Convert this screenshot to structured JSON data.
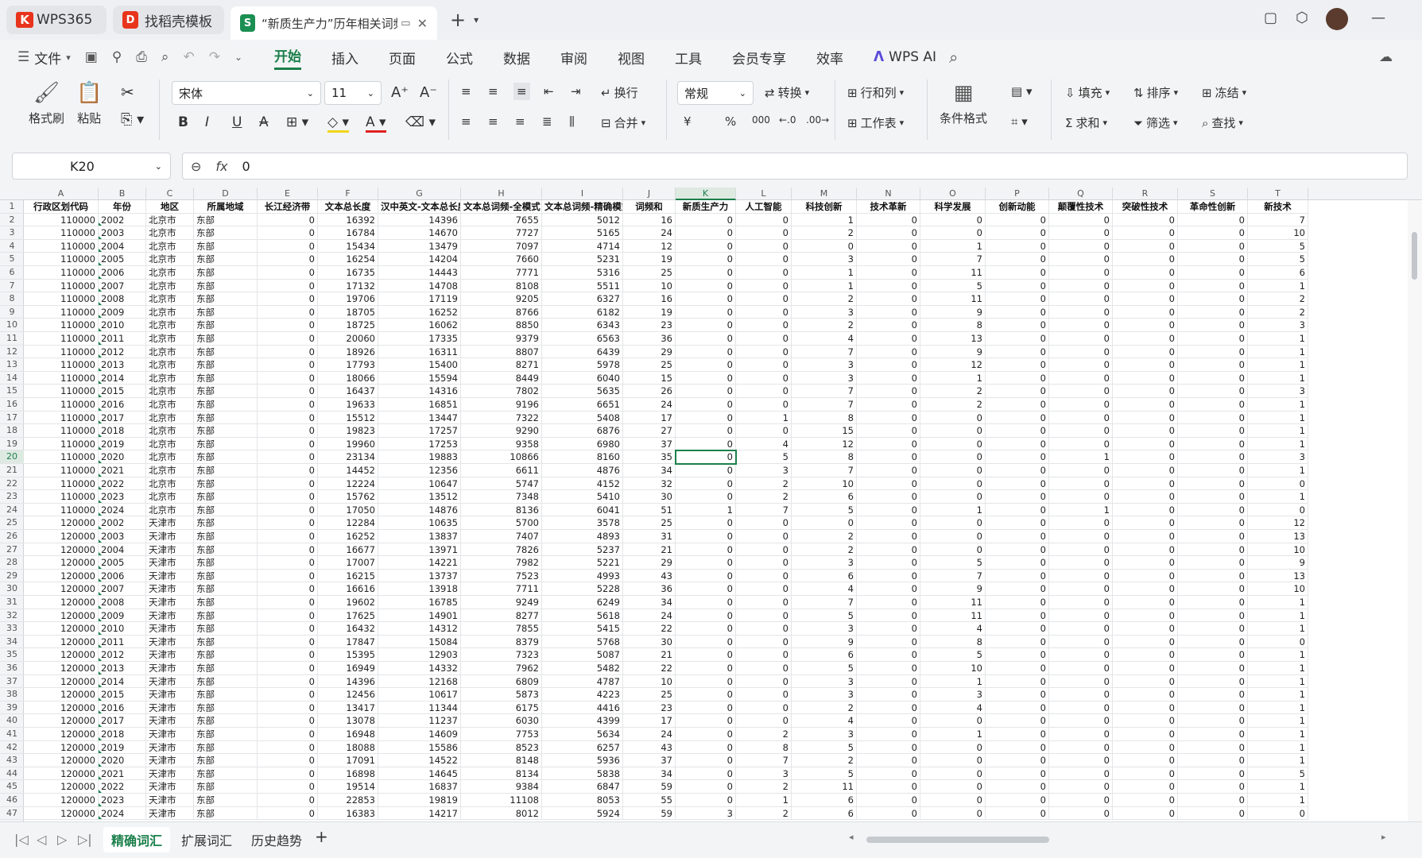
{
  "titlebar": {
    "tabs": [
      {
        "label": "WPS365"
      },
      {
        "label": "找稻壳模板"
      },
      {
        "label": "“新质生产力”历年相关词频-"
      }
    ],
    "new_tab": "+"
  },
  "menubar": {
    "file": "文件",
    "items": [
      "开始",
      "插入",
      "页面",
      "公式",
      "数据",
      "审阅",
      "视图",
      "工具",
      "会员专享",
      "效率"
    ],
    "active": "开始",
    "wps_ai": "WPS AI"
  },
  "ribbon": {
    "format_painter": "格式刷",
    "paste": "粘贴",
    "font_name": "宋体",
    "font_size": "11",
    "wrap": "换行",
    "merge": "合并",
    "number_format": "常规",
    "convert": "转换",
    "rows_cols": "行和列",
    "worksheet": "工作表",
    "cond_format": "条件格式",
    "fill": "填充",
    "sort": "排序",
    "freeze": "冻结",
    "sum": "求和",
    "filter": "筛选",
    "find": "查找",
    "bold": "B",
    "italic": "I",
    "underline": "U",
    "strike": "A",
    "currency": "¥",
    "percent": "%",
    "thousands": "000"
  },
  "formula_bar": {
    "cell_ref": "K20",
    "fx": "fx",
    "value": "0"
  },
  "grid": {
    "col_letters": [
      "A",
      "B",
      "C",
      "D",
      "E",
      "F",
      "G",
      "H",
      "I",
      "J",
      "K",
      "L",
      "M",
      "N",
      "O",
      "P",
      "Q",
      "R",
      "S",
      "T"
    ],
    "headers": [
      "行政区划代码",
      "年份",
      "地区",
      "所属地域",
      "长江经济带",
      "文本总长度",
      "汉中英文-文本总长度",
      "文本总词频-全模式",
      "文本总词频-精确模式",
      "词频和",
      "新质生产力",
      "人工智能",
      "科技创新",
      "技术革新",
      "科学发展",
      "创新动能",
      "颠覆性技术",
      "突破性技术",
      "革命性创新",
      "新技术"
    ],
    "rows": [
      [
        "110000",
        "2002",
        "北京市",
        "东部",
        "0",
        "16392",
        "14396",
        "7655",
        "5012",
        "16",
        "0",
        "0",
        "1",
        "0",
        "0",
        "0",
        "0",
        "0",
        "0",
        "7"
      ],
      [
        "110000",
        "2003",
        "北京市",
        "东部",
        "0",
        "16784",
        "14670",
        "7727",
        "5165",
        "24",
        "0",
        "0",
        "2",
        "0",
        "0",
        "0",
        "0",
        "0",
        "0",
        "10"
      ],
      [
        "110000",
        "2004",
        "北京市",
        "东部",
        "0",
        "15434",
        "13479",
        "7097",
        "4714",
        "12",
        "0",
        "0",
        "0",
        "0",
        "1",
        "0",
        "0",
        "0",
        "0",
        "5"
      ],
      [
        "110000",
        "2005",
        "北京市",
        "东部",
        "0",
        "16254",
        "14204",
        "7660",
        "5231",
        "19",
        "0",
        "0",
        "3",
        "0",
        "7",
        "0",
        "0",
        "0",
        "0",
        "5"
      ],
      [
        "110000",
        "2006",
        "北京市",
        "东部",
        "0",
        "16735",
        "14443",
        "7771",
        "5316",
        "25",
        "0",
        "0",
        "1",
        "0",
        "11",
        "0",
        "0",
        "0",
        "0",
        "6"
      ],
      [
        "110000",
        "2007",
        "北京市",
        "东部",
        "0",
        "17132",
        "14708",
        "8108",
        "5511",
        "10",
        "0",
        "0",
        "1",
        "0",
        "5",
        "0",
        "0",
        "0",
        "0",
        "1"
      ],
      [
        "110000",
        "2008",
        "北京市",
        "东部",
        "0",
        "19706",
        "17119",
        "9205",
        "6327",
        "16",
        "0",
        "0",
        "2",
        "0",
        "11",
        "0",
        "0",
        "0",
        "0",
        "2"
      ],
      [
        "110000",
        "2009",
        "北京市",
        "东部",
        "0",
        "18705",
        "16252",
        "8766",
        "6182",
        "19",
        "0",
        "0",
        "3",
        "0",
        "9",
        "0",
        "0",
        "0",
        "0",
        "2"
      ],
      [
        "110000",
        "2010",
        "北京市",
        "东部",
        "0",
        "18725",
        "16062",
        "8850",
        "6343",
        "23",
        "0",
        "0",
        "2",
        "0",
        "8",
        "0",
        "0",
        "0",
        "0",
        "3"
      ],
      [
        "110000",
        "2011",
        "北京市",
        "东部",
        "0",
        "20060",
        "17335",
        "9379",
        "6563",
        "36",
        "0",
        "0",
        "4",
        "0",
        "13",
        "0",
        "0",
        "0",
        "0",
        "1"
      ],
      [
        "110000",
        "2012",
        "北京市",
        "东部",
        "0",
        "18926",
        "16311",
        "8807",
        "6439",
        "29",
        "0",
        "0",
        "7",
        "0",
        "9",
        "0",
        "0",
        "0",
        "0",
        "1"
      ],
      [
        "110000",
        "2013",
        "北京市",
        "东部",
        "0",
        "17793",
        "15400",
        "8271",
        "5978",
        "25",
        "0",
        "0",
        "3",
        "0",
        "12",
        "0",
        "0",
        "0",
        "0",
        "1"
      ],
      [
        "110000",
        "2014",
        "北京市",
        "东部",
        "0",
        "18066",
        "15594",
        "8449",
        "6040",
        "15",
        "0",
        "0",
        "3",
        "0",
        "1",
        "0",
        "0",
        "0",
        "0",
        "1"
      ],
      [
        "110000",
        "2015",
        "北京市",
        "东部",
        "0",
        "16437",
        "14316",
        "7802",
        "5635",
        "26",
        "0",
        "0",
        "7",
        "0",
        "2",
        "0",
        "0",
        "0",
        "0",
        "3"
      ],
      [
        "110000",
        "2016",
        "北京市",
        "东部",
        "0",
        "19633",
        "16851",
        "9196",
        "6651",
        "24",
        "0",
        "0",
        "7",
        "0",
        "2",
        "0",
        "0",
        "0",
        "0",
        "1"
      ],
      [
        "110000",
        "2017",
        "北京市",
        "东部",
        "0",
        "15512",
        "13447",
        "7322",
        "5408",
        "17",
        "0",
        "1",
        "8",
        "0",
        "0",
        "0",
        "0",
        "0",
        "0",
        "1"
      ],
      [
        "110000",
        "2018",
        "北京市",
        "东部",
        "0",
        "19823",
        "17257",
        "9290",
        "6876",
        "27",
        "0",
        "0",
        "15",
        "0",
        "0",
        "0",
        "0",
        "0",
        "0",
        "1"
      ],
      [
        "110000",
        "2019",
        "北京市",
        "东部",
        "0",
        "19960",
        "17253",
        "9358",
        "6980",
        "37",
        "0",
        "4",
        "12",
        "0",
        "0",
        "0",
        "0",
        "0",
        "0",
        "1"
      ],
      [
        "110000",
        "2020",
        "北京市",
        "东部",
        "0",
        "23134",
        "19883",
        "10866",
        "8160",
        "35",
        "0",
        "5",
        "8",
        "0",
        "0",
        "0",
        "1",
        "0",
        "0",
        "3"
      ],
      [
        "110000",
        "2021",
        "北京市",
        "东部",
        "0",
        "14452",
        "12356",
        "6611",
        "4876",
        "34",
        "0",
        "3",
        "7",
        "0",
        "0",
        "0",
        "0",
        "0",
        "0",
        "1"
      ],
      [
        "110000",
        "2022",
        "北京市",
        "东部",
        "0",
        "12224",
        "10647",
        "5747",
        "4152",
        "32",
        "0",
        "2",
        "10",
        "0",
        "0",
        "0",
        "0",
        "0",
        "0",
        "0"
      ],
      [
        "110000",
        "2023",
        "北京市",
        "东部",
        "0",
        "15762",
        "13512",
        "7348",
        "5410",
        "30",
        "0",
        "2",
        "6",
        "0",
        "0",
        "0",
        "0",
        "0",
        "0",
        "1"
      ],
      [
        "110000",
        "2024",
        "北京市",
        "东部",
        "0",
        "17050",
        "14876",
        "8136",
        "6041",
        "51",
        "1",
        "7",
        "5",
        "0",
        "1",
        "0",
        "1",
        "0",
        "0",
        "0"
      ],
      [
        "120000",
        "2002",
        "天津市",
        "东部",
        "0",
        "12284",
        "10635",
        "5700",
        "3578",
        "25",
        "0",
        "0",
        "0",
        "0",
        "0",
        "0",
        "0",
        "0",
        "0",
        "12"
      ],
      [
        "120000",
        "2003",
        "天津市",
        "东部",
        "0",
        "16252",
        "13837",
        "7407",
        "4893",
        "31",
        "0",
        "0",
        "2",
        "0",
        "0",
        "0",
        "0",
        "0",
        "0",
        "13"
      ],
      [
        "120000",
        "2004",
        "天津市",
        "东部",
        "0",
        "16677",
        "13971",
        "7826",
        "5237",
        "21",
        "0",
        "0",
        "2",
        "0",
        "0",
        "0",
        "0",
        "0",
        "0",
        "10"
      ],
      [
        "120000",
        "2005",
        "天津市",
        "东部",
        "0",
        "17007",
        "14221",
        "7982",
        "5221",
        "29",
        "0",
        "0",
        "3",
        "0",
        "5",
        "0",
        "0",
        "0",
        "0",
        "9"
      ],
      [
        "120000",
        "2006",
        "天津市",
        "东部",
        "0",
        "16215",
        "13737",
        "7523",
        "4993",
        "43",
        "0",
        "0",
        "6",
        "0",
        "7",
        "0",
        "0",
        "0",
        "0",
        "13"
      ],
      [
        "120000",
        "2007",
        "天津市",
        "东部",
        "0",
        "16616",
        "13918",
        "7711",
        "5228",
        "36",
        "0",
        "0",
        "4",
        "0",
        "9",
        "0",
        "0",
        "0",
        "0",
        "10"
      ],
      [
        "120000",
        "2008",
        "天津市",
        "东部",
        "0",
        "19602",
        "16785",
        "9249",
        "6249",
        "34",
        "0",
        "0",
        "7",
        "0",
        "11",
        "0",
        "0",
        "0",
        "0",
        "1"
      ],
      [
        "120000",
        "2009",
        "天津市",
        "东部",
        "0",
        "17625",
        "14901",
        "8277",
        "5618",
        "24",
        "0",
        "0",
        "5",
        "0",
        "11",
        "0",
        "0",
        "0",
        "0",
        "1"
      ],
      [
        "120000",
        "2010",
        "天津市",
        "东部",
        "0",
        "16432",
        "14312",
        "7855",
        "5415",
        "22",
        "0",
        "0",
        "3",
        "0",
        "4",
        "0",
        "0",
        "0",
        "0",
        "1"
      ],
      [
        "120000",
        "2011",
        "天津市",
        "东部",
        "0",
        "17847",
        "15084",
        "8379",
        "5768",
        "30",
        "0",
        "0",
        "9",
        "0",
        "8",
        "0",
        "0",
        "0",
        "0",
        "0"
      ],
      [
        "120000",
        "2012",
        "天津市",
        "东部",
        "0",
        "15395",
        "12903",
        "7323",
        "5087",
        "21",
        "0",
        "0",
        "6",
        "0",
        "5",
        "0",
        "0",
        "0",
        "0",
        "1"
      ],
      [
        "120000",
        "2013",
        "天津市",
        "东部",
        "0",
        "16949",
        "14332",
        "7962",
        "5482",
        "22",
        "0",
        "0",
        "5",
        "0",
        "10",
        "0",
        "0",
        "0",
        "0",
        "1"
      ],
      [
        "120000",
        "2014",
        "天津市",
        "东部",
        "0",
        "14396",
        "12168",
        "6809",
        "4787",
        "10",
        "0",
        "0",
        "3",
        "0",
        "1",
        "0",
        "0",
        "0",
        "0",
        "1"
      ],
      [
        "120000",
        "2015",
        "天津市",
        "东部",
        "0",
        "12456",
        "10617",
        "5873",
        "4223",
        "25",
        "0",
        "0",
        "3",
        "0",
        "3",
        "0",
        "0",
        "0",
        "0",
        "1"
      ],
      [
        "120000",
        "2016",
        "天津市",
        "东部",
        "0",
        "13417",
        "11344",
        "6175",
        "4416",
        "23",
        "0",
        "0",
        "2",
        "0",
        "4",
        "0",
        "0",
        "0",
        "0",
        "1"
      ],
      [
        "120000",
        "2017",
        "天津市",
        "东部",
        "0",
        "13078",
        "11237",
        "6030",
        "4399",
        "17",
        "0",
        "0",
        "4",
        "0",
        "0",
        "0",
        "0",
        "0",
        "0",
        "1"
      ],
      [
        "120000",
        "2018",
        "天津市",
        "东部",
        "0",
        "16948",
        "14609",
        "7753",
        "5634",
        "24",
        "0",
        "2",
        "3",
        "0",
        "1",
        "0",
        "0",
        "0",
        "0",
        "1"
      ],
      [
        "120000",
        "2019",
        "天津市",
        "东部",
        "0",
        "18088",
        "15586",
        "8523",
        "6257",
        "43",
        "0",
        "8",
        "5",
        "0",
        "0",
        "0",
        "0",
        "0",
        "0",
        "1"
      ],
      [
        "120000",
        "2020",
        "天津市",
        "东部",
        "0",
        "17091",
        "14522",
        "8148",
        "5936",
        "37",
        "0",
        "7",
        "2",
        "0",
        "0",
        "0",
        "0",
        "0",
        "0",
        "1"
      ],
      [
        "120000",
        "2021",
        "天津市",
        "东部",
        "0",
        "16898",
        "14645",
        "8134",
        "5838",
        "34",
        "0",
        "3",
        "5",
        "0",
        "0",
        "0",
        "0",
        "0",
        "0",
        "5"
      ],
      [
        "120000",
        "2022",
        "天津市",
        "东部",
        "0",
        "19514",
        "16837",
        "9384",
        "6847",
        "59",
        "0",
        "2",
        "11",
        "0",
        "0",
        "0",
        "0",
        "0",
        "0",
        "1"
      ],
      [
        "120000",
        "2023",
        "天津市",
        "东部",
        "0",
        "22853",
        "19819",
        "11108",
        "8053",
        "55",
        "0",
        "1",
        "6",
        "0",
        "0",
        "0",
        "0",
        "0",
        "0",
        "1"
      ],
      [
        "120000",
        "2024",
        "天津市",
        "东部",
        "0",
        "16383",
        "14217",
        "8012",
        "5924",
        "59",
        "3",
        "2",
        "6",
        "0",
        "0",
        "0",
        "0",
        "0",
        "0",
        "0"
      ]
    ],
    "selected_cell": "K20"
  },
  "sheets": {
    "tabs": [
      "精确词汇",
      "扩展词汇",
      "历史趋势"
    ],
    "active": "精确词汇",
    "add": "+"
  },
  "colors": {
    "accent": "#1b7f4b",
    "wps_red": "#e8341c"
  }
}
